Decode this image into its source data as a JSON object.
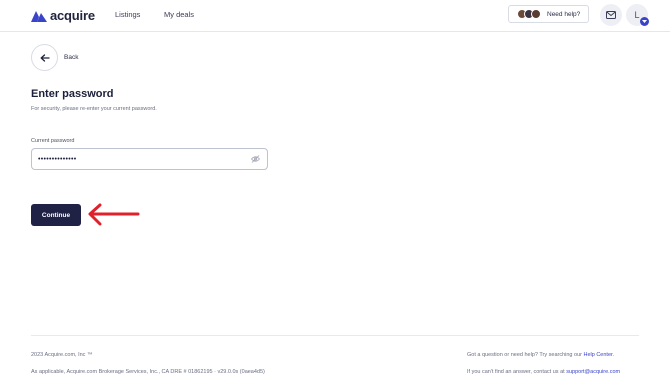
{
  "header": {
    "logo_text": "acquire",
    "nav": {
      "listings": "Listings",
      "my_deals": "My deals"
    },
    "help_button": "Need help?",
    "user_initial": "L"
  },
  "back": {
    "label": "Back"
  },
  "form": {
    "title": "Enter password",
    "subtitle": "For security, please re-enter your current password.",
    "field_label": "Current password",
    "field_value": "••••••••••••••",
    "submit_label": "Continue"
  },
  "footer": {
    "copyright": "2023 Acquire.com, Inc ™",
    "legal": "As applicable, Acquire.com Brokerage Services, Inc., CA DRE # 01862195 · v29.0.0s (0aea4d5)",
    "help_prefix": "Got a question or need help? Try searching our",
    "help_link": "Help Center",
    "contact_prefix": "If you can't find an answer, contact us at",
    "contact_email": "support@acquire.com"
  },
  "colors": {
    "brand": "#3a44c9",
    "button_dark": "#1f2245",
    "annotation_arrow": "#e0202a"
  },
  "icons": {
    "logo": "acquire-logo-icon",
    "help_avatars": "support-avatars",
    "mail": "mail-icon",
    "user_menu": "chevron-down-icon",
    "back": "arrow-left-icon",
    "password_visibility": "eye-off-icon",
    "annotation": "red-arrow-left-icon"
  }
}
